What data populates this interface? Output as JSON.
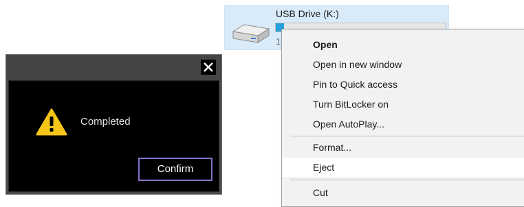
{
  "drive": {
    "name": "USB Drive (K:)",
    "usage_fraction": 0.05,
    "size_text": "1",
    "icon": "usb-drive-icon",
    "tile_color": "#d9ebf9",
    "bar_color": "#26a0da"
  },
  "context_menu": {
    "items": [
      {
        "label": "Open",
        "bold": true
      },
      {
        "label": "Open in new window"
      },
      {
        "label": "Pin to Quick access"
      },
      {
        "label": "Turn BitLocker on"
      },
      {
        "label": "Open AutoPlay..."
      },
      {
        "label": "Format..."
      },
      {
        "label": "Eject",
        "hovered": true
      },
      {
        "label": "Cut"
      }
    ]
  },
  "dialog": {
    "message": "Completed",
    "confirm_label": "Confirm",
    "icon": "warning-icon",
    "close_icon": "close-icon",
    "accent_color": "#8a72c8",
    "warning_color": "#f5c518"
  }
}
